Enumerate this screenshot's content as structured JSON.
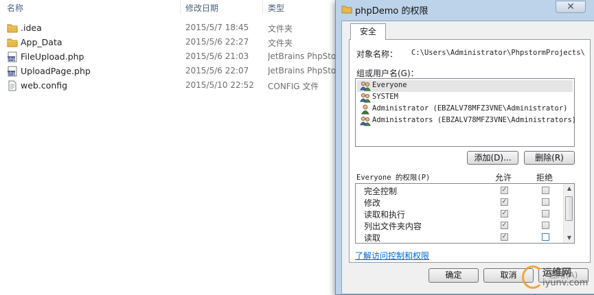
{
  "explorer": {
    "columns": {
      "name": "名称",
      "date": "修改日期",
      "type": "类型"
    },
    "files": [
      {
        "name": ".idea",
        "date": "2015/5/7 18:45",
        "type": "文件夹",
        "icon": "folder-icon"
      },
      {
        "name": "App_Data",
        "date": "2015/5/6 22:27",
        "type": "文件夹",
        "icon": "folder-icon"
      },
      {
        "name": "FileUpload.php",
        "date": "2015/5/6 21:03",
        "type": "JetBrains PhpStorm",
        "icon": "php-file-icon"
      },
      {
        "name": "UploadPage.php",
        "date": "2015/5/6 22:07",
        "type": "JetBrains PhpStorm",
        "icon": "php-file-icon"
      },
      {
        "name": "web.config",
        "date": "2015/5/10 22:52",
        "type": "CONFIG 文件",
        "icon": "config-file-icon"
      }
    ]
  },
  "dialog": {
    "title": "phpDemo 的权限",
    "close_label": "✕",
    "tab_label": "安全",
    "object_label": "对象名称：",
    "object_value": "C:\\Users\\Administrator\\PhpstormProjects\\",
    "group_label": "组或用户名(G)：",
    "users": [
      {
        "name": "Everyone",
        "icon": "group-icon",
        "selected": true
      },
      {
        "name": "SYSTEM",
        "icon": "group-icon",
        "selected": false
      },
      {
        "name": "Administrator (EBZALV78MFZ3VNE\\Administrator)",
        "icon": "user-icon",
        "selected": false
      },
      {
        "name": "Administrators (EBZALV78MFZ3VNE\\Administrators)",
        "icon": "group-icon",
        "selected": false
      }
    ],
    "add_button": "添加(D)...",
    "remove_button": "删除(R)",
    "permissions_label": "Everyone 的权限(P)",
    "allow_header": "允许",
    "deny_header": "拒绝",
    "permissions": [
      {
        "name": "完全控制",
        "allow": true,
        "deny": false
      },
      {
        "name": "修改",
        "allow": true,
        "deny": false
      },
      {
        "name": "读取和执行",
        "allow": true,
        "deny": false
      },
      {
        "name": "列出文件夹内容",
        "allow": true,
        "deny": false
      },
      {
        "name": "读取",
        "allow": true,
        "deny": false
      }
    ],
    "help_link": "了解访问控制和权限",
    "ok_button": "确定",
    "cancel_button": "取消",
    "apply_button": "应用(A)"
  },
  "watermark": {
    "line1": "运维网",
    "line2": "iyunv.com"
  },
  "colors": {
    "accent_link": "#0066cc",
    "dialog_frame": "#bcd3ea",
    "folder": "#e8b84a"
  }
}
